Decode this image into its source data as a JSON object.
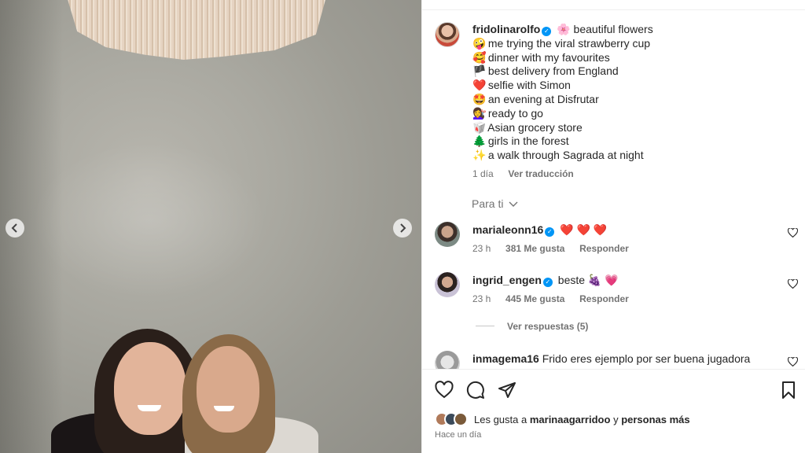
{
  "post": {
    "username": "fridolinarolfo",
    "caption_lines": [
      {
        "emoji": "🌸",
        "text": "beautiful flowers"
      },
      {
        "emoji": "🤪",
        "text": "me trying the viral strawberry cup"
      },
      {
        "emoji": "🥰",
        "text": "dinner with my favourites"
      },
      {
        "emoji": "🏴",
        "text": "best delivery from England"
      },
      {
        "emoji": "❤️",
        "text": "selfie with Simon"
      },
      {
        "emoji": "🤩",
        "text": "an evening at Disfrutar"
      },
      {
        "emoji": "💇‍♀️",
        "text": "ready to go"
      },
      {
        "emoji": "🥡",
        "text": "Asian grocery store"
      },
      {
        "emoji": "🌲",
        "text": "girls in the forest"
      },
      {
        "emoji": "✨",
        "text": "a walk through Sagrada at night"
      }
    ],
    "age": "1 día",
    "translate": "Ver traducción"
  },
  "sort_label": "Para ti",
  "comments": [
    {
      "username": "marialeonn16",
      "verified": true,
      "text": "❤️ ❤️ ❤️",
      "age": "23 h",
      "likes": "381 Me gusta",
      "reply": "Responder"
    },
    {
      "username": "ingrid_engen",
      "verified": true,
      "text": "beste 🍇 💗",
      "age": "23 h",
      "likes": "445 Me gusta",
      "reply": "Responder"
    },
    {
      "username": "inmagema16",
      "verified": false,
      "text": "Frido eres ejemplo por ser buena jugadora pero sobre todo por buena persona y luchadora",
      "age": "",
      "likes": "",
      "reply": ""
    }
  ],
  "view_replies": "Ver respuestas (5)",
  "likes_summary": {
    "prefix": "Les gusta a",
    "user": "marinaagarridoo",
    "middle": "y",
    "suffix": "personas más"
  },
  "timestamp": "Hace un día",
  "icons": {
    "like": "heart-icon",
    "comment": "comment-icon",
    "share": "share-icon",
    "save": "bookmark-icon",
    "prev": "chevron-left-icon",
    "next": "chevron-right-icon",
    "sort": "chevron-down-icon"
  },
  "colors": {
    "verified": "#0095f6",
    "muted": "#737373",
    "text": "#262626"
  }
}
